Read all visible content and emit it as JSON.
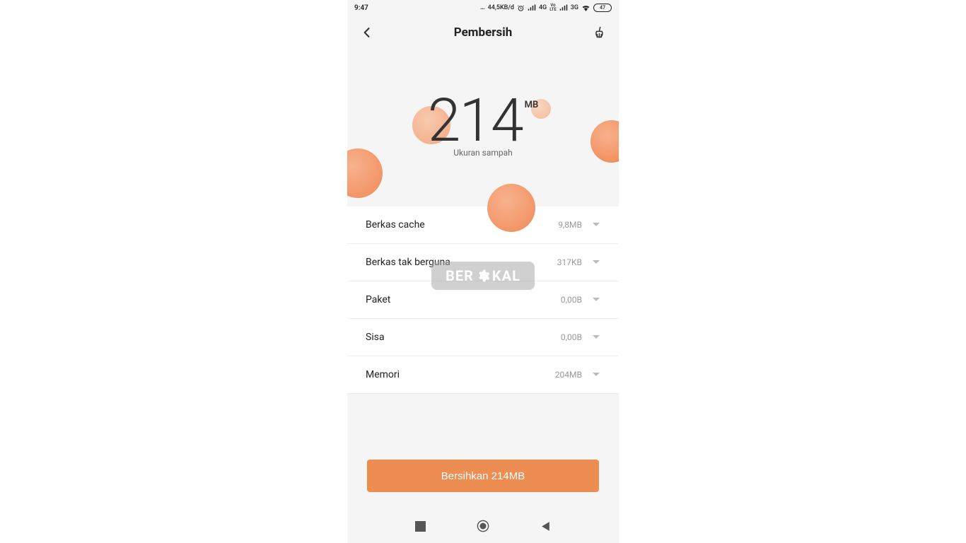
{
  "status": {
    "time": "9:47",
    "data_rate": "44,5KB/d",
    "net1": "4G",
    "lte_top": "Vo",
    "lte_bot": "LTE",
    "net2": "3G",
    "battery": "47"
  },
  "header": {
    "title": "Pembersih"
  },
  "hero": {
    "value": "214",
    "unit": "MB",
    "subtitle": "Ukuran sampah"
  },
  "rows": [
    {
      "label": "Berkas cache",
      "size": "9,8MB"
    },
    {
      "label": "Berkas tak berguna",
      "size": "317KB"
    },
    {
      "label": "Paket",
      "size": "0,00B"
    },
    {
      "label": "Sisa",
      "size": "0,00B"
    },
    {
      "label": "Memori",
      "size": "204MB"
    }
  ],
  "action": {
    "label": "Bersihkan 214MB"
  },
  "watermark": {
    "left": "BER",
    "right": "KAL"
  },
  "colors": {
    "accent": "#ee8d52",
    "bubble_light": "#f9c2a2",
    "bubble_dark": "#ef844f"
  }
}
